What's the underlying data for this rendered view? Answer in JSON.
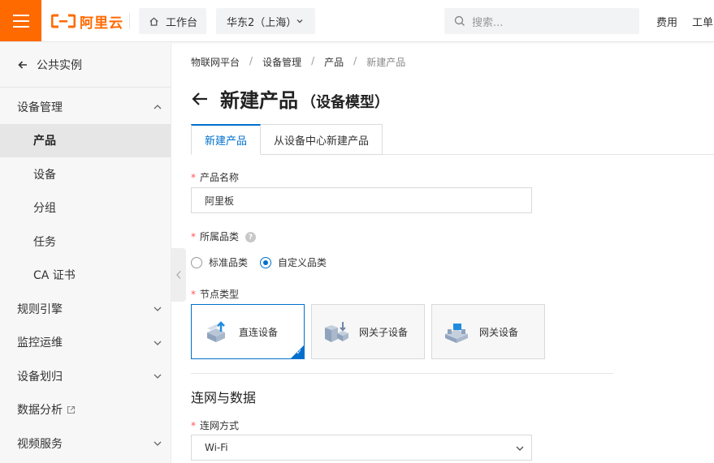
{
  "header": {
    "logo_text": "阿里云",
    "workbench_label": "工作台",
    "region_label": "华东2（上海）",
    "search_placeholder": "搜索...",
    "links": [
      "费用",
      "工单"
    ],
    "brand_color": "#ff6a00"
  },
  "sidebar": {
    "back_label": "公共实例",
    "items": [
      {
        "label": "设备管理",
        "type": "group",
        "expanded": true
      },
      {
        "label": "产品",
        "type": "sub",
        "active": true
      },
      {
        "label": "设备",
        "type": "sub"
      },
      {
        "label": "分组",
        "type": "sub"
      },
      {
        "label": "任务",
        "type": "sub"
      },
      {
        "label": "CA 证书",
        "type": "sub"
      },
      {
        "label": "规则引擎",
        "type": "group"
      },
      {
        "label": "监控运维",
        "type": "group"
      },
      {
        "label": "设备划归",
        "type": "group"
      },
      {
        "label": "数据分析",
        "type": "group",
        "external": true
      },
      {
        "label": "视频服务",
        "type": "group"
      }
    ]
  },
  "breadcrumb": [
    "物联网平台",
    "设备管理",
    "产品",
    "新建产品"
  ],
  "page": {
    "title": "新建产品",
    "subtitle": "（设备模型）"
  },
  "tabs": [
    {
      "label": "新建产品",
      "active": true
    },
    {
      "label": "从设备中心新建产品",
      "active": false
    }
  ],
  "form": {
    "product_name": {
      "label": "产品名称",
      "value": "阿里板"
    },
    "category": {
      "label": "所属品类",
      "options": [
        {
          "label": "标准品类",
          "selected": false
        },
        {
          "label": "自定义品类",
          "selected": true
        }
      ]
    },
    "node_type": {
      "label": "节点类型",
      "cards": [
        {
          "label": "直连设备",
          "selected": true,
          "icon": "direct-device-icon"
        },
        {
          "label": "网关子设备",
          "selected": false,
          "icon": "gateway-sub-device-icon"
        },
        {
          "label": "网关设备",
          "selected": false,
          "icon": "gateway-device-icon"
        }
      ]
    },
    "section_title": "连网与数据",
    "network": {
      "label": "连网方式",
      "value": "Wi-Fi"
    }
  },
  "accent_color": "#0070cc"
}
